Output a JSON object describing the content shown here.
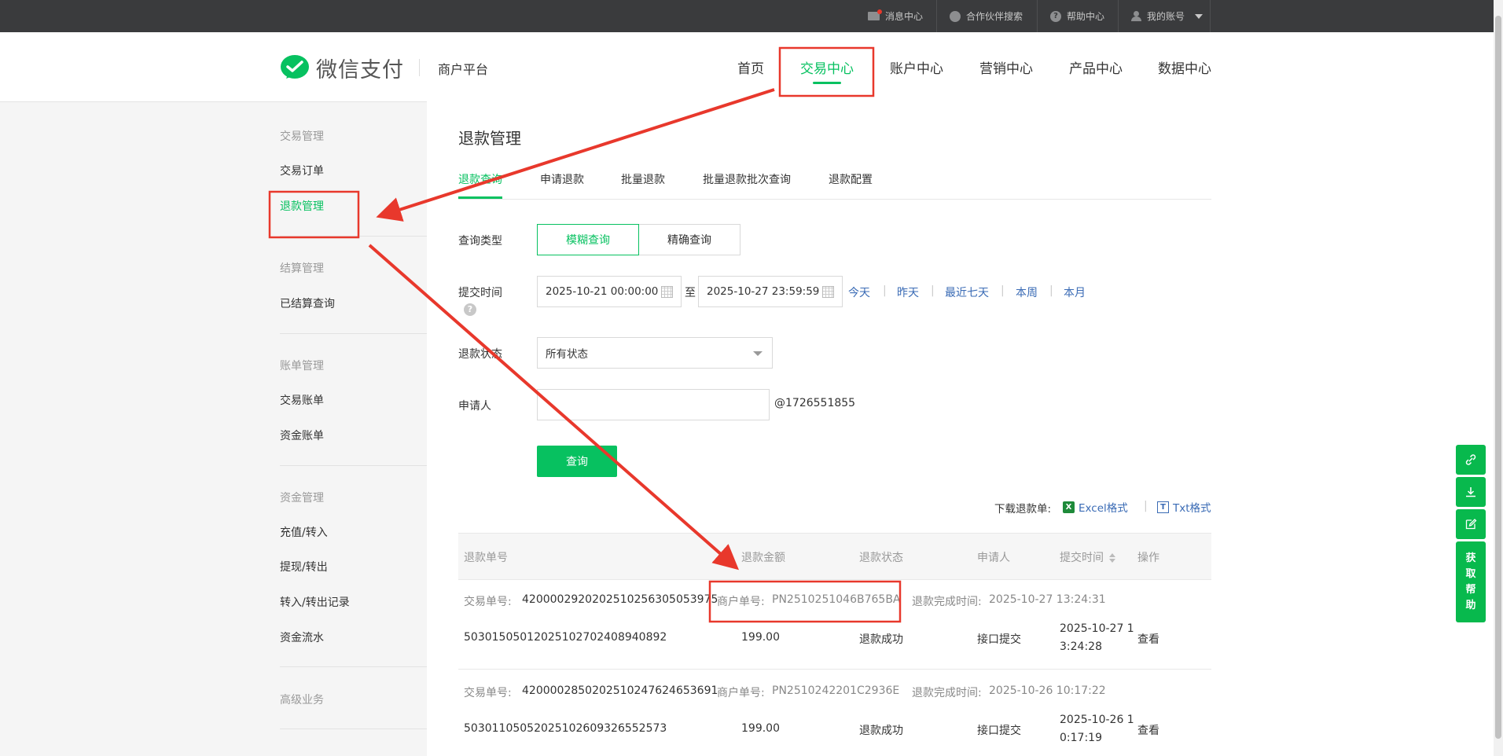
{
  "topbar": {
    "messages": "消息中心",
    "partner_search": "合作伙伴搜索",
    "help_center": "帮助中心",
    "my_account": "我的账号"
  },
  "header": {
    "logo_text": "微信支付",
    "platform": "商户平台",
    "nav": [
      "首页",
      "交易中心",
      "账户中心",
      "营销中心",
      "产品中心",
      "数据中心"
    ],
    "active_nav": "交易中心"
  },
  "sidebar": {
    "groups": [
      {
        "title": "交易管理",
        "items": [
          "交易订单",
          "退款管理"
        ]
      },
      {
        "title": "结算管理",
        "items": [
          "已结算查询"
        ]
      },
      {
        "title": "账单管理",
        "items": [
          "交易账单",
          "资金账单"
        ]
      },
      {
        "title": "资金管理",
        "items": [
          "充值/转入",
          "提现/转出",
          "转入/转出记录",
          "资金流水"
        ]
      },
      {
        "title": "高级业务",
        "items": []
      }
    ],
    "active_item": "退款管理"
  },
  "page": {
    "title": "退款管理",
    "tabs": [
      "退款查询",
      "申请退款",
      "批量退款",
      "批量退款批次查询",
      "退款配置"
    ],
    "active_tab": "退款查询"
  },
  "form": {
    "query_type_label": "查询类型",
    "query_type_options": [
      "模糊查询",
      "精确查询"
    ],
    "selected_query_type": "模糊查询",
    "submit_time_label": "提交时间",
    "start_time": "2025-10-21 00:00:00",
    "to_label": "至",
    "end_time": "2025-10-27 23:59:59",
    "quick_ranges": [
      "今天",
      "昨天",
      "最近七天",
      "本周",
      "本月"
    ],
    "status_label": "退款状态",
    "status_value": "所有状态",
    "applicant_label": "申请人",
    "applicant_value": "",
    "applicant_suffix": "@1726551855",
    "query_button": "查询"
  },
  "download": {
    "label": "下载退款单:",
    "excel": "Excel格式",
    "txt": "Txt格式"
  },
  "table": {
    "headers": [
      "退款单号",
      "退款金额",
      "退款状态",
      "申请人",
      "提交时间",
      "操作"
    ],
    "rows": [
      {
        "txn_label": "交易单号:",
        "txn_no": "4200002920202510256305053975",
        "merchant_label": "商户单号:",
        "merchant_no": "PN2510251046B765BA",
        "done_label": "退款完成时间:",
        "done_time": "2025-10-27 13:24:31",
        "refund_no": "50301505012025102702408940892",
        "amount": "199.00",
        "status": "退款成功",
        "applicant": "接口提交",
        "submit_line1": "2025-10-27 1",
        "submit_line2": "3:24:28",
        "action": "查看"
      },
      {
        "txn_label": "交易单号:",
        "txn_no": "4200002850202510247624653691",
        "merchant_label": "商户单号:",
        "merchant_no": "PN2510242201C2936E",
        "done_label": "退款完成时间:",
        "done_time": "2025-10-26 10:17:22",
        "refund_no": "50301105052025102609326552573",
        "amount": "199.00",
        "status": "退款成功",
        "applicant": "接口提交",
        "submit_line1": "2025-10-26 1",
        "submit_line2": "0:17:19",
        "action": "查看"
      }
    ]
  },
  "help_rail": {
    "get_help": "获取帮助",
    "icons": [
      "link-icon",
      "download-icon",
      "edit-icon"
    ]
  },
  "colors": {
    "brand": "#07c160",
    "link": "#3a6bb5",
    "annotation": "#e8382c",
    "topbar": "#3a3b3d"
  }
}
